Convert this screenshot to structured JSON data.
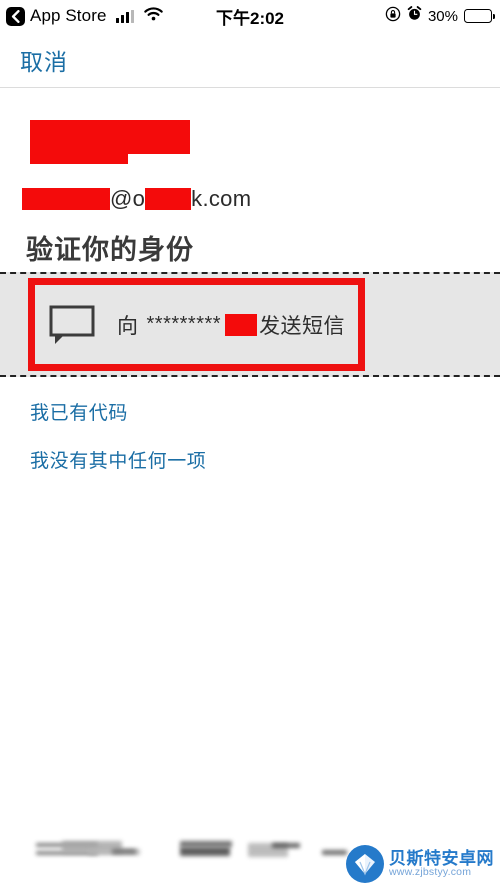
{
  "status_bar": {
    "back_app_label": "App Store",
    "back_icon": "chevron-left-icon",
    "signal_icon": "cellular-signal-icon",
    "wifi_icon": "wifi-icon",
    "time": "下午2:02",
    "rotation_lock_icon": "rotation-lock-icon",
    "alarm_icon": "alarm-clock-icon",
    "battery_percent": "30%",
    "battery_level": 30
  },
  "navbar": {
    "cancel_label": "取消"
  },
  "account": {
    "name_redacted": "",
    "email_prefix_redacted": "",
    "email_at": "@o",
    "email_mid_redacted": "",
    "email_suffix": "k.com"
  },
  "main": {
    "heading": "验证你的身份",
    "option": {
      "icon": "message-bubble-icon",
      "prefix": "向",
      "masked_number": "*********",
      "masked_redacted": "",
      "suffix": "发送短信"
    },
    "links": [
      {
        "label": "我已有代码"
      },
      {
        "label": "我没有其中任何一项"
      }
    ]
  },
  "watermark": {
    "site_name": "贝斯特安卓网",
    "site_url": "www.zjbstyy.com",
    "logo_icon": "shell-logo-icon"
  },
  "colors": {
    "link_blue": "#1b6ea5",
    "redaction_red": "#f40b0b",
    "highlight_red": "#ee1111",
    "band_gray": "#e6e6e6",
    "watermark_blue": "#1a73c8"
  }
}
